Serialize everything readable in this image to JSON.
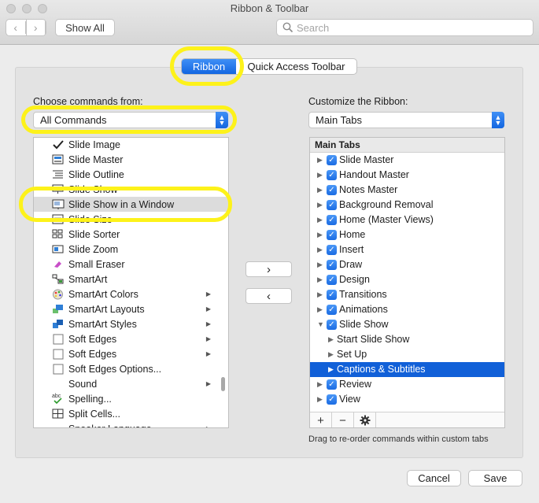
{
  "window": {
    "title": "Ribbon & Toolbar"
  },
  "toolbar": {
    "back_icon": "chevron-left-icon",
    "forward_icon": "chevron-right-icon",
    "show_all_label": "Show All",
    "search_placeholder": "Search"
  },
  "tabs": {
    "ribbon": "Ribbon",
    "quick_access": "Quick Access Toolbar",
    "selected": "Ribbon"
  },
  "left": {
    "label": "Choose commands from:",
    "dropdown_value": "All Commands",
    "items": [
      {
        "label": "Slide Image",
        "icon": "checkmark-icon"
      },
      {
        "label": "Slide Master",
        "icon": "slide-master-icon"
      },
      {
        "label": "Slide Outline",
        "icon": "outline-icon"
      },
      {
        "label": "Slide Show",
        "icon": "slideshow-icon"
      },
      {
        "label": "Slide Show in a Window",
        "icon": "slideshow-window-icon",
        "selected": true
      },
      {
        "label": "Slide Size",
        "icon": "slide-size-icon"
      },
      {
        "label": "Slide Sorter",
        "icon": "slide-sorter-icon"
      },
      {
        "label": "Slide Zoom",
        "icon": "slide-zoom-icon"
      },
      {
        "label": "Small Eraser",
        "icon": "eraser-icon"
      },
      {
        "label": "SmartArt",
        "icon": "smartart-icon"
      },
      {
        "label": "SmartArt Colors",
        "icon": "palette-icon",
        "submenu": true
      },
      {
        "label": "SmartArt Layouts",
        "icon": "smartart-layouts-icon",
        "submenu": true
      },
      {
        "label": "SmartArt Styles",
        "icon": "smartart-styles-icon",
        "submenu": true
      },
      {
        "label": "Soft Edges",
        "icon": "empty-box-icon",
        "submenu": true
      },
      {
        "label": "Soft Edges",
        "icon": "empty-box-icon",
        "submenu": true
      },
      {
        "label": "Soft Edges Options...",
        "icon": "empty-box-icon"
      },
      {
        "label": "Sound",
        "icon": "",
        "submenu": true
      },
      {
        "label": "Spelling...",
        "icon": "spelling-icon"
      },
      {
        "label": "Split Cells...",
        "icon": "split-cells-icon"
      },
      {
        "label": "Speaker Language",
        "icon": "",
        "submenu": true
      }
    ]
  },
  "middle": {
    "add_icon": "chevron-right-icon",
    "remove_icon": "chevron-left-icon"
  },
  "right": {
    "label": "Customize the Ribbon:",
    "dropdown_value": "Main Tabs",
    "header": "Main Tabs",
    "items": [
      {
        "label": "Slide Master",
        "checked": true
      },
      {
        "label": "Handout Master",
        "checked": true
      },
      {
        "label": "Notes Master",
        "checked": true
      },
      {
        "label": "Background Removal",
        "checked": true
      },
      {
        "label": "Home (Master Views)",
        "checked": true
      },
      {
        "label": "Home",
        "checked": true
      },
      {
        "label": "Insert",
        "checked": true
      },
      {
        "label": "Draw",
        "checked": true
      },
      {
        "label": "Design",
        "checked": true
      },
      {
        "label": "Transitions",
        "checked": true
      },
      {
        "label": "Animations",
        "checked": true
      },
      {
        "label": "Slide Show",
        "checked": true,
        "expanded": true
      },
      {
        "label": "Start Slide Show",
        "child": true
      },
      {
        "label": "Set Up",
        "child": true
      },
      {
        "label": "Captions & Subtitles",
        "child": true,
        "selected": true
      },
      {
        "label": "Review",
        "checked": true
      },
      {
        "label": "View",
        "checked": true
      }
    ],
    "footer": {
      "add": "+",
      "remove": "−",
      "settings_icon": "gear-icon"
    },
    "hint": "Drag to re-order commands within custom tabs"
  },
  "buttons": {
    "cancel": "Cancel",
    "save": "Save"
  },
  "colors": {
    "accent": "#1366e1",
    "selection": "#1160d8",
    "highlight": "#fdf21a"
  }
}
